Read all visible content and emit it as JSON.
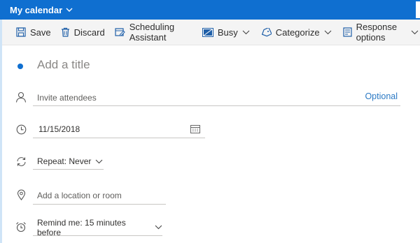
{
  "header": {
    "calendar_label": "My calendar"
  },
  "toolbar": {
    "save": "Save",
    "discard": "Discard",
    "scheduling": "Scheduling Assistant",
    "busy": "Busy",
    "categorize": "Categorize",
    "response": "Response options"
  },
  "event": {
    "title_placeholder": "Add a title",
    "attendees_placeholder": "Invite attendees",
    "optional_label": "Optional",
    "date": "11/15/2018",
    "repeat": "Repeat:  Never",
    "location_placeholder": "Add a location or room",
    "remind": "Remind me:  15 minutes before"
  },
  "colors": {
    "accent": "#0f6fd0",
    "link": "#2b79c4",
    "toolbar_bg": "#f4f4f4"
  }
}
